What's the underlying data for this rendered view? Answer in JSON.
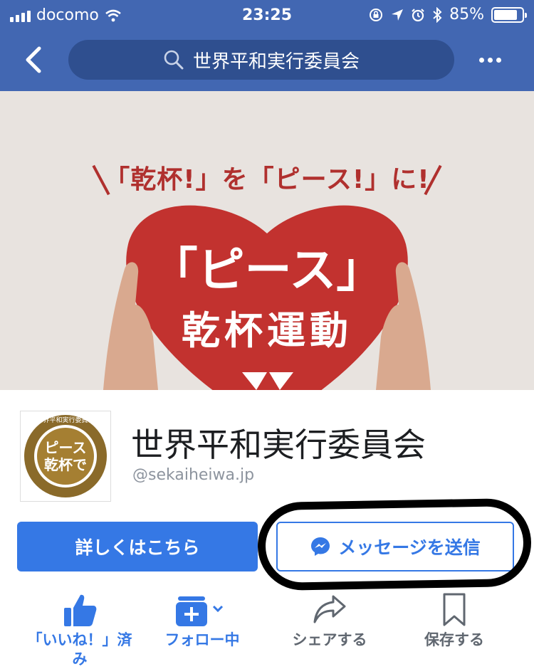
{
  "status_bar": {
    "carrier": "docomo",
    "time": "23:25",
    "battery": "85%",
    "battery_level": 0.85
  },
  "nav": {
    "search_text": "世界平和実行委員会",
    "icons": [
      "back-arrow-icon",
      "search-icon",
      "more-dots-icon"
    ]
  },
  "cover": {
    "tagline": "「乾杯!」を「ピース!」に!",
    "title": "「ピース」",
    "subtitle": "乾杯運動",
    "colors": {
      "heart": "#c2322f",
      "background": "#e8e3df"
    }
  },
  "profile": {
    "logo_text": "ピース乾杯で",
    "logo_ring_text": "世界平和実行委員会",
    "name": "世界平和実行委員会",
    "handle": "@sekaiheiwa.jp"
  },
  "buttons": {
    "primary": "詳しくはこちら",
    "message": "メッセージを送信"
  },
  "actions": [
    {
      "label": "「いいね！」済み",
      "icon": "thumbs-up-icon"
    },
    {
      "label": "フォロー中",
      "icon": "follow-icon"
    },
    {
      "label": "シェアする",
      "icon": "share-icon"
    },
    {
      "label": "保存する",
      "icon": "bookmark-icon"
    }
  ],
  "colors": {
    "brand_blue": "#4267b2",
    "button_blue": "#3578e5",
    "action_gray": "#606770"
  }
}
